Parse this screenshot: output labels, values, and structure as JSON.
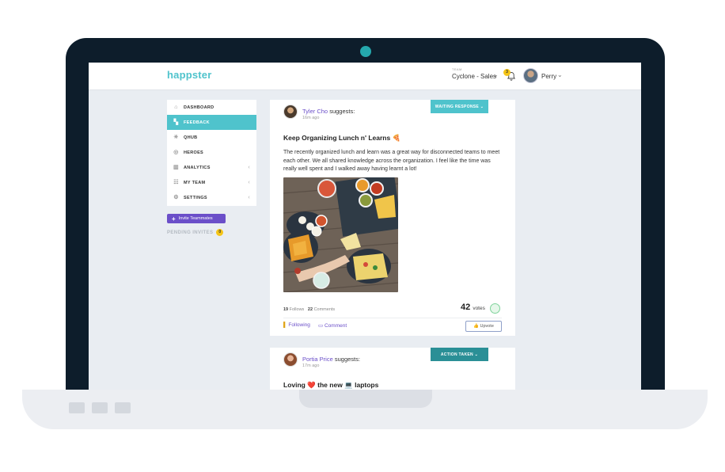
{
  "topbar": {
    "logo": "happster",
    "team_label": "TEAM",
    "team_name": "Cyclone - Sales",
    "team_chevron": "⌄",
    "notification_count": "3",
    "user_name": "Perry",
    "user_chevron": "⌄"
  },
  "sidebar": {
    "items": [
      {
        "label": "DASHBOARD",
        "icon": "⌂"
      },
      {
        "label": "FEEDBACK",
        "icon": "▚"
      },
      {
        "label": "QHUB",
        "icon": "✳"
      },
      {
        "label": "HEROES",
        "icon": "◎"
      },
      {
        "label": "ANALYTICS",
        "icon": "▥",
        "chevron": "‹"
      },
      {
        "label": "MY TEAM",
        "icon": "☷",
        "chevron": "‹"
      },
      {
        "label": "SETTINGS",
        "icon": "⚙",
        "chevron": "‹"
      }
    ],
    "invite_plus": "+",
    "invite_label": "Invite Teammates",
    "pending_label": "PENDING INVITES",
    "pending_count": "0"
  },
  "posts": [
    {
      "status": "WAITING RESPONSE",
      "status_chevron": "⌄",
      "author": "Tyler Cho",
      "suggests": " suggests:",
      "time": "16m ago",
      "title": "Keep Organizing Lunch n' Learns 🍕",
      "body": "The recently organized lunch and learn was a great way for disconnected teams to meet each other. We all shared knowledge across the organization. I feel like the time was really well spent and I walked away having learnt a lot!",
      "follows_count": "19",
      "follows_label": "Follows",
      "comments_count": "22",
      "comments_label": "Comments",
      "votes": "42",
      "votes_label": "votes",
      "following_icon": "▌",
      "following_label": "Following",
      "comment_icon": "▭",
      "comment_label": "Comment",
      "upvote_icon": "👍",
      "upvote_label": "Upvote"
    },
    {
      "status": "ACTION TAKEN",
      "status_chevron": "⌄",
      "author": "Portia Price",
      "suggests": " suggests:",
      "time": "17m ago",
      "title": "Loving ❤️ the new 💻 laptops"
    }
  ],
  "colors": {
    "accent": "#4fc3cc",
    "purple": "#6b4fc9",
    "badge": "#f5c518",
    "action_taken": "#2a8f96"
  }
}
